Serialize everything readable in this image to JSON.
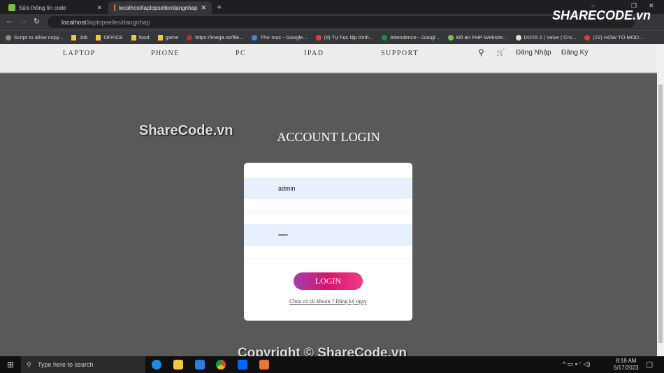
{
  "browser": {
    "tabs": [
      {
        "label": "Sửa thông tin code"
      },
      {
        "label": "localhost/laptopseller/dangnhap"
      }
    ],
    "url_host": "localhost",
    "url_path": "/laptopseller/dangnhap",
    "bookmarks": [
      "Script to allow copy...",
      "Job",
      "OFFICE",
      "food",
      "game",
      "https://mega.nz/file...",
      "Thư mục - Google...",
      "(9) Tự học lập trình...",
      "Attendence - Googl...",
      "Đồ án PHP Website...",
      "DOTA 2 | Valve | Cro...",
      "(22) HOW TO MOD..."
    ]
  },
  "nav": {
    "items": [
      "LAPTOP",
      "PHONE",
      "PC",
      "IPAD",
      "SUPPORT"
    ],
    "login": "Đăng Nhập",
    "register": "Đăng Ký"
  },
  "page": {
    "title": "ACCOUNT LOGIN",
    "username": "admin",
    "password": "•••••",
    "login_button": "LOGIN",
    "register_link": "Chưa có tài khoản ? Đăng ký ngay"
  },
  "watermark": {
    "top": "ShareCode.vn",
    "bottom": "Copyright © ShareCode.vn",
    "logo": "SHARECODE.vn"
  },
  "taskbar": {
    "search_placeholder": "Type here to search",
    "time": "8:18 AM",
    "date": "5/17/2023"
  },
  "colors": {
    "accent_start": "#a23fb0",
    "accent_end": "#f03c88",
    "input_bg": "#e8f0fe"
  }
}
